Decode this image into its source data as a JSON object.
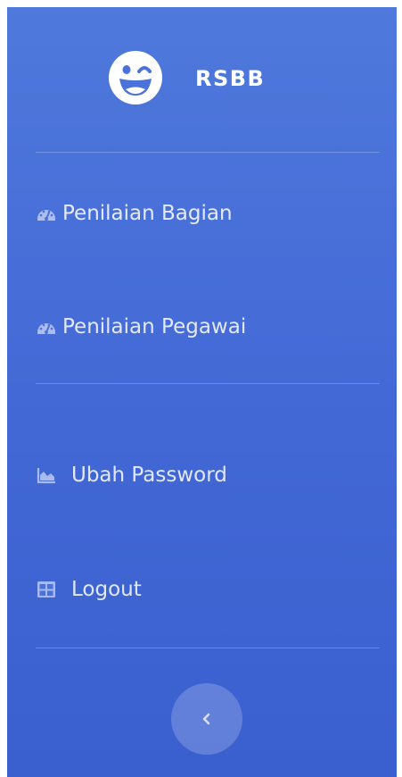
{
  "brand": {
    "name": "RSBB"
  },
  "nav": {
    "items": [
      {
        "label": "Penilaian Bagian",
        "icon": "tachometer-icon"
      },
      {
        "label": "Penilaian Pegawai",
        "icon": "tachometer-icon"
      },
      {
        "label": "Ubah Password",
        "icon": "area-chart-icon"
      },
      {
        "label": "Logout",
        "icon": "table-icon"
      }
    ]
  },
  "toggle": {
    "icon": "chevron-left-icon"
  },
  "colors": {
    "sidebar_top": "#4f79dc",
    "sidebar_bottom": "#3a5fcf",
    "text": "#ffffff"
  }
}
